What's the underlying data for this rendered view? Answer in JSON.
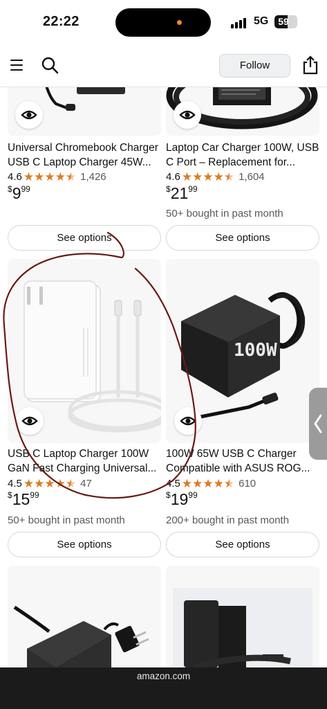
{
  "status_bar": {
    "time": "22:22",
    "network": "5G",
    "battery": "59",
    "battery_level": 0.59
  },
  "header": {
    "follow_label": "Follow"
  },
  "colors": {
    "star": "#de7921",
    "annotation": "#6b1a14",
    "pill_border": "#d5d9d9"
  },
  "products": [
    {
      "title_line1": "Universal Chromebook Charger",
      "title_line2": "USB C Laptop Charger 45W...",
      "rating": "4.6",
      "stars": 4.5,
      "reviews": "1,426",
      "currency": "$",
      "price_whole": "9",
      "price_fraction": "99",
      "bought": "",
      "options_label": "See options"
    },
    {
      "title_line1": "Laptop Car Charger 100W, USB",
      "title_line2": "C Port – Replacement for...",
      "rating": "4.6",
      "stars": 4.5,
      "reviews": "1,604",
      "currency": "$",
      "price_whole": "21",
      "price_fraction": "99",
      "bought": "50+ bought in past month",
      "options_label": "See options"
    },
    {
      "title_line1": "USB C Laptop Charger 100W",
      "title_line2": "GaN Fast Charging Universal...",
      "rating": "4.5",
      "stars": 4.5,
      "reviews": "47",
      "currency": "$",
      "price_whole": "15",
      "price_fraction": "99",
      "bought": "50+ bought in past month",
      "options_label": "See options"
    },
    {
      "title_line1": "100W 65W USB C Charger",
      "title_line2": "Compatible with ASUS ROG...",
      "rating": "4.5",
      "stars": 4.5,
      "reviews": "610",
      "currency": "$",
      "price_whole": "19",
      "price_fraction": "99",
      "bought": "200+ bought in past month",
      "options_label": "See options"
    }
  ],
  "product_images": {
    "p4_label": "100W"
  },
  "bottom_bar": {
    "url": "amazon.com"
  }
}
